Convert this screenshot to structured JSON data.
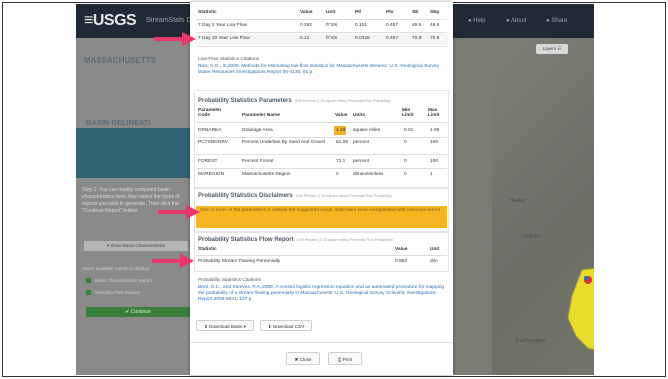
{
  "app": {
    "logo": "≡USGS",
    "app_name": "StreamStats Da...",
    "header_links": [
      "● Help",
      "● About",
      "● Share"
    ],
    "state_title": "MASSACHUSETTS",
    "basin_title": "BASIN DELINEATI",
    "step_text": "Step 1: You can modify computed basin characteristics here, then select the types of reports you wish to generate. Then click the \"Continue Report\" button",
    "show_basin_btn": "▾ Show Basin Characteristics",
    "select_reports": "Select available reports to display:",
    "checkboxes": [
      "Basin Characteristics Report",
      "Scenario Flow Reports"
    ],
    "continue_btn": "✔ Continue",
    "layers_btn": "Layers ☰",
    "map_labels": [
      "Hadley",
      "Hatfield",
      "Easthampton"
    ]
  },
  "modal": {
    "flow_table": {
      "headers": [
        "Statistic",
        "Value",
        "Unit",
        "PIl",
        "Plu",
        "SE",
        "SEp"
      ],
      "rows": [
        [
          "7 Day 2 Year Low Flow",
          "0.292",
          "ft^3/s",
          "0.101",
          "0.457",
          "49.5",
          "49.5"
        ],
        [
          "7 Day 10 Year Low Flow",
          "0.12",
          "ft^3/s",
          "0.0326",
          "0.497",
          "70.8",
          "70.8"
        ]
      ]
    },
    "low_flow_citations_title": "Low-Flow Statistics Citations",
    "low_flow_citation": "Ries, K.G., III,2000, Methods for estimating low-flow statistics for Massachusetts streams: U.S. Geological Survey Water Resources Investigations Report 00-4135, 81 p.",
    "prob_params_title": "Probability Statistics Parameters",
    "prob_params_sub": "(200 Percent (1.33 square miles) Perennial Flow Probability)",
    "params_headers": [
      "Parameter Code",
      "Parameter Name",
      "Value",
      "Units",
      "Min Limit",
      "Max Limit"
    ],
    "params_rows": [
      [
        "DRNAREA",
        "Drainage Area",
        "1.33",
        "square miles",
        "0.01",
        "1.99"
      ],
      [
        "PCTSNDGRV",
        "Percent Underlain By Sand And Gravel",
        "61.05",
        "percent",
        "0",
        "100"
      ],
      [
        "FOREST",
        "Percent Forest",
        "72.1",
        "percent",
        "0",
        "100"
      ],
      [
        "MAREGION",
        "Massachusetts Region",
        "0",
        "dimensionless",
        "0",
        "1"
      ]
    ],
    "disclaimers_title": "Probability Statistics Disclaimers",
    "disclaimers_sub": "(100 Percent (1.33 square miles) Perennial Flow Probability)",
    "disclaimer_text": "One or more of the parameters is outside the suggested range. Estimates were extrapolated with unknown errors",
    "flow_report_title": "Probability Statistics Flow Report",
    "flow_report_sub": "(100 Percent (1.33 square miles) Perennial Flow Probability)",
    "flow_report_headers": [
      "Statistic",
      "Value",
      "Unit"
    ],
    "flow_report_rows": [
      [
        "Probability Stream Flowing Perennially",
        "0.953",
        "dim"
      ]
    ],
    "prob_citations_title": "Probability Statistics Citations",
    "prob_citation": "Bent, G.C., and Steeves, P.A.,2006, A revised logistic regression equation and an automated procedure for mapping the probability of a stream flowing perennially in Massachusetts: U.S. Geological Survey Scientific Investigations Report 2006-5031, 107 p.",
    "download_basin_btn": "⬇ Download Basin ▾",
    "download_csv_btn": "⬇ Download CSV",
    "close_btn": "✖ Close",
    "print_btn": "⎙ Print"
  },
  "colors": {
    "annotation_arrow": "#e6396b",
    "warning": "#f5b622",
    "link": "#2a6fb0",
    "basin_fill": "#e8dc2a"
  }
}
